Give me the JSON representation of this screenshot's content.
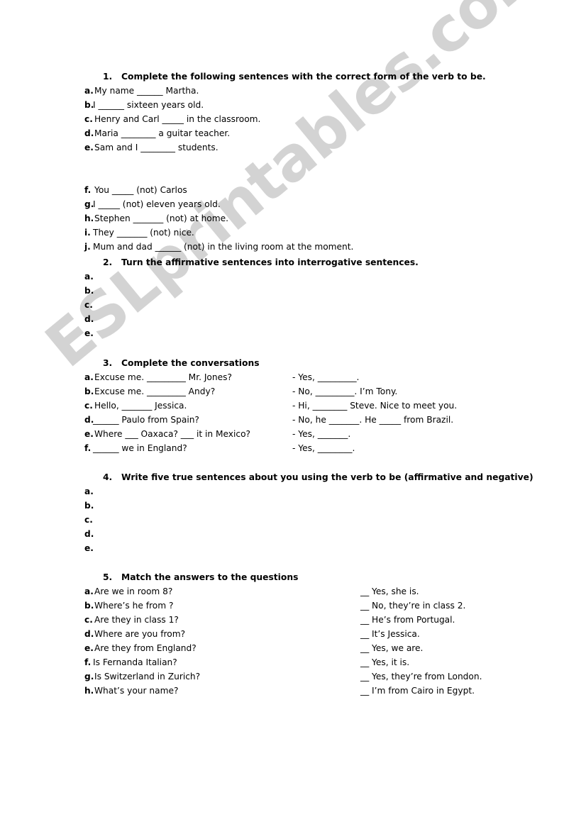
{
  "document": {
    "watermark": "ESLprintables.com",
    "watermark_color": "#d3d3d3",
    "text_color": "#000000",
    "background_color": "#ffffff"
  },
  "exercises": [
    {
      "number": "1.",
      "title": "Complete the following sentences with the correct form of the verb to be.",
      "items_group_1": [
        {
          "label": "a.",
          "text": "My name ______ Martha."
        },
        {
          "label": "b.",
          "text": "I ______ sixteen years old."
        },
        {
          "label": "c.",
          "text": "Henry and Carl _____ in the classroom."
        },
        {
          "label": "d.",
          "text": "Maria ________ a guitar teacher."
        },
        {
          "label": "e.",
          "text": "Sam and I ________ students."
        }
      ],
      "items_group_2": [
        {
          "label": "f.",
          "text": "You _____ (not) Carlos"
        },
        {
          "label": "g.",
          "text": "I _____ (not) eleven years old."
        },
        {
          "label": "h.",
          "text": "Stephen _______ (not) at home."
        },
        {
          "label": "i.",
          "text": "They _______ (not) nice."
        },
        {
          "label": "j.",
          "text": "Mum and dad ______ (not) in the living room at the moment."
        }
      ]
    },
    {
      "number": "2.",
      "title": "Turn the affirmative sentences into interrogative sentences.",
      "items": [
        {
          "label": "a.",
          "text": ""
        },
        {
          "label": "b.",
          "text": ""
        },
        {
          "label": "c.",
          "text": ""
        },
        {
          "label": "d.",
          "text": ""
        },
        {
          "label": "e.",
          "text": ""
        }
      ]
    },
    {
      "number": "3.",
      "title": "Complete the conversations",
      "items": [
        {
          "label": "a.",
          "text": "Excuse me. _________ Mr. Jones?",
          "answer": "- Yes, _________."
        },
        {
          "label": "b.",
          "text": "Excuse me. _________ Andy?",
          "answer": "- No, _________. I’m Tony."
        },
        {
          "label": "c.",
          "text": "Hello, _______ Jessica.",
          "answer": "- Hi, ________ Steve. Nice to meet you."
        },
        {
          "label": "d.",
          "text": "______ Paulo from Spain?",
          "answer": "- No, he _______. He _____ from Brazil."
        },
        {
          "label": "e.",
          "text": "Where ___ Oaxaca? ___ it in Mexico?",
          "answer": "- Yes, _______."
        },
        {
          "label": "f.",
          "text": "______ we in England?",
          "answer": "- Yes, ________."
        }
      ]
    },
    {
      "number": "4.",
      "title": "Write five true sentences about you using the verb to be (affirmative and negative)",
      "items": [
        {
          "label": "a.",
          "text": ""
        },
        {
          "label": "b.",
          "text": ""
        },
        {
          "label": "c.",
          "text": ""
        },
        {
          "label": "d.",
          "text": ""
        },
        {
          "label": "e.",
          "text": ""
        }
      ]
    },
    {
      "number": "5.",
      "title": "Match the answers to the questions",
      "items": [
        {
          "label": "a.",
          "text": "Are we in room 8?",
          "answer": "__ Yes, she is."
        },
        {
          "label": "b.",
          "text": "Where’s he from ?",
          "answer": "__ No, they’re in class 2."
        },
        {
          "label": "c.",
          "text": "Are they in class 1?",
          "answer": "__ He’s from Portugal."
        },
        {
          "label": "d.",
          "text": "Where are you from?",
          "answer": "__ It’s Jessica."
        },
        {
          "label": "e.",
          "text": "Are they from England?",
          "answer": "__ Yes, we are."
        },
        {
          "label": "f.",
          "text": "Is Fernanda Italian?",
          "answer": "__ Yes, it is."
        },
        {
          "label": "g.",
          "text": "Is Switzerland in Zurich?",
          "answer": "__ Yes, they’re from London."
        },
        {
          "label": "h.",
          "text": "What’s your name?",
          "answer": "__ I’m from Cairo in Egypt."
        }
      ]
    }
  ]
}
